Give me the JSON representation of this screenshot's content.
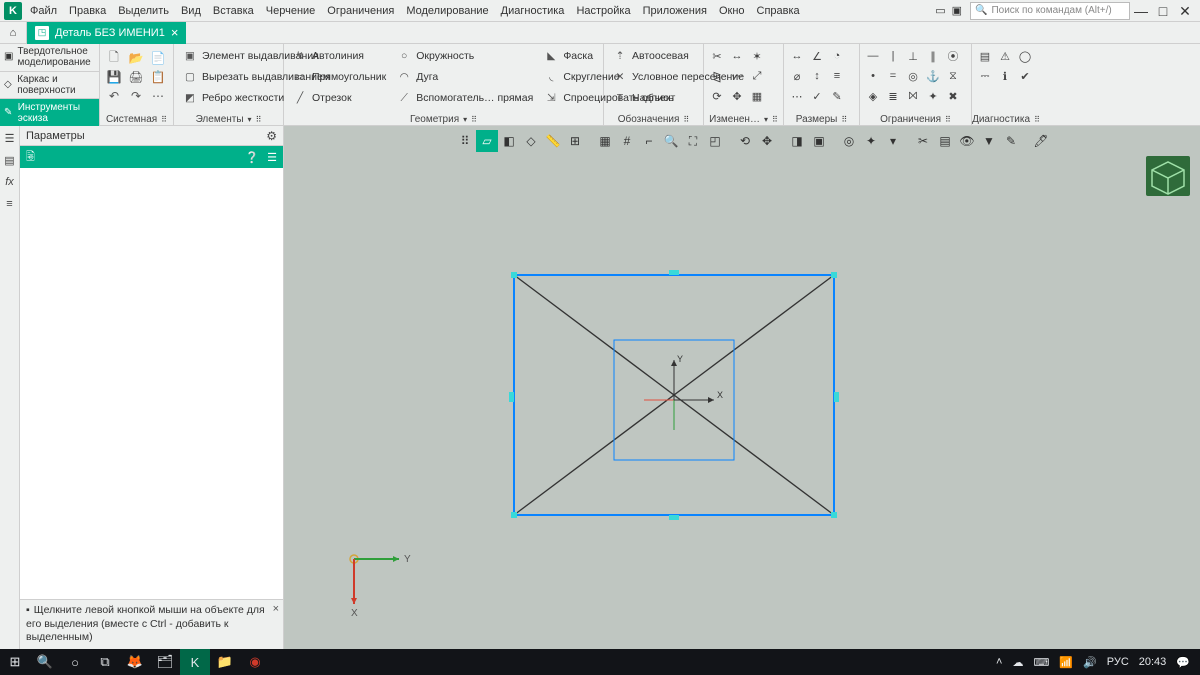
{
  "menu": [
    "Файл",
    "Правка",
    "Выделить",
    "Вид",
    "Вставка",
    "Черчение",
    "Ограничения",
    "Моделирование",
    "Диагностика",
    "Настройка",
    "Приложения",
    "Окно",
    "Справка"
  ],
  "search_placeholder": "Поиск по командам (Alt+/)",
  "doc_title": "Деталь БЕЗ ИМЕНИ1",
  "side_tabs": {
    "solid": "Твердотельное моделирование",
    "wire": "Каркас и поверхности",
    "sketch": "Инструменты эскиза"
  },
  "ribbon_labels": {
    "system": "Системная",
    "elements": "Элементы",
    "geometry": "Геометрия",
    "annotations": "Обозначения",
    "changes": "Изменен…",
    "dimensions": "Размеры",
    "constraints": "Ограничения",
    "diagnostics": "Диагностика"
  },
  "cmds": {
    "extrude": "Элемент выдавливания",
    "cut": "Вырезать выдавливанием",
    "rib": "Ребро жесткости",
    "autoline": "Автолиния",
    "rect": "Прямоугольник",
    "segment": "Отрезок",
    "circle": "Окружность",
    "arc": "Дуга",
    "aux": "Вспомогатель… прямая",
    "chamfer": "Фаска",
    "fillet": "Скругление",
    "project": "Спроецировать объект",
    "axis": "Автоосевая",
    "cond": "Условное пересечение",
    "text": "Надпись"
  },
  "panel": {
    "title": "Параметры"
  },
  "hint": "Щелкните левой кнопкой мыши на объекте для его выделения (вместе с Ctrl - добавить к выделенным)",
  "axis": {
    "x": "X",
    "y": "Y"
  },
  "tray": {
    "lang": "РУС",
    "time": "20:43"
  }
}
